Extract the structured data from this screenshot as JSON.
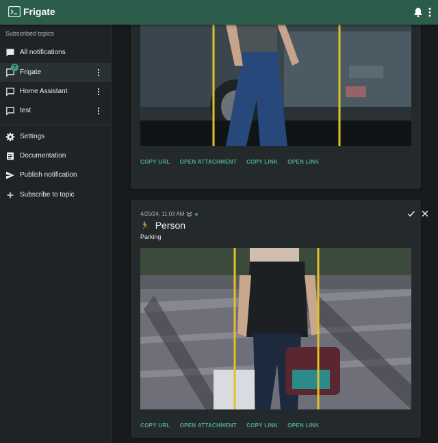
{
  "app": {
    "title": "Frigate"
  },
  "sidebar": {
    "heading": "Subscribed topics",
    "items": [
      {
        "label": "All notifications",
        "icon": "chat-icon"
      },
      {
        "label": "Frigate",
        "icon": "chat-outline-icon",
        "badge": "7"
      },
      {
        "label": "Home Assistant",
        "icon": "chat-outline-icon"
      },
      {
        "label": "test",
        "icon": "chat-outline-icon"
      }
    ],
    "links": [
      {
        "label": "Settings",
        "icon": "gear-icon"
      },
      {
        "label": "Documentation",
        "icon": "document-icon"
      },
      {
        "label": "Publish notification",
        "icon": "send-icon"
      },
      {
        "label": "Subscribe to topic",
        "icon": "plus-icon"
      }
    ]
  },
  "cards": [
    {
      "actions": [
        "COPY URL",
        "OPEN ATTACHMENT",
        "COPY LINK",
        "OPEN LINK"
      ]
    },
    {
      "timestamp": "4/20/24, 11:03 AM",
      "emoji": "🏃",
      "title": "Person",
      "subtitle": "Parking",
      "actions": [
        "COPY URL",
        "OPEN ATTACHMENT",
        "COPY LINK",
        "OPEN LINK"
      ]
    }
  ],
  "colors": {
    "appbar": "#2c5c4a",
    "accent": "#3d9c7f",
    "action": "#4fa88a"
  }
}
